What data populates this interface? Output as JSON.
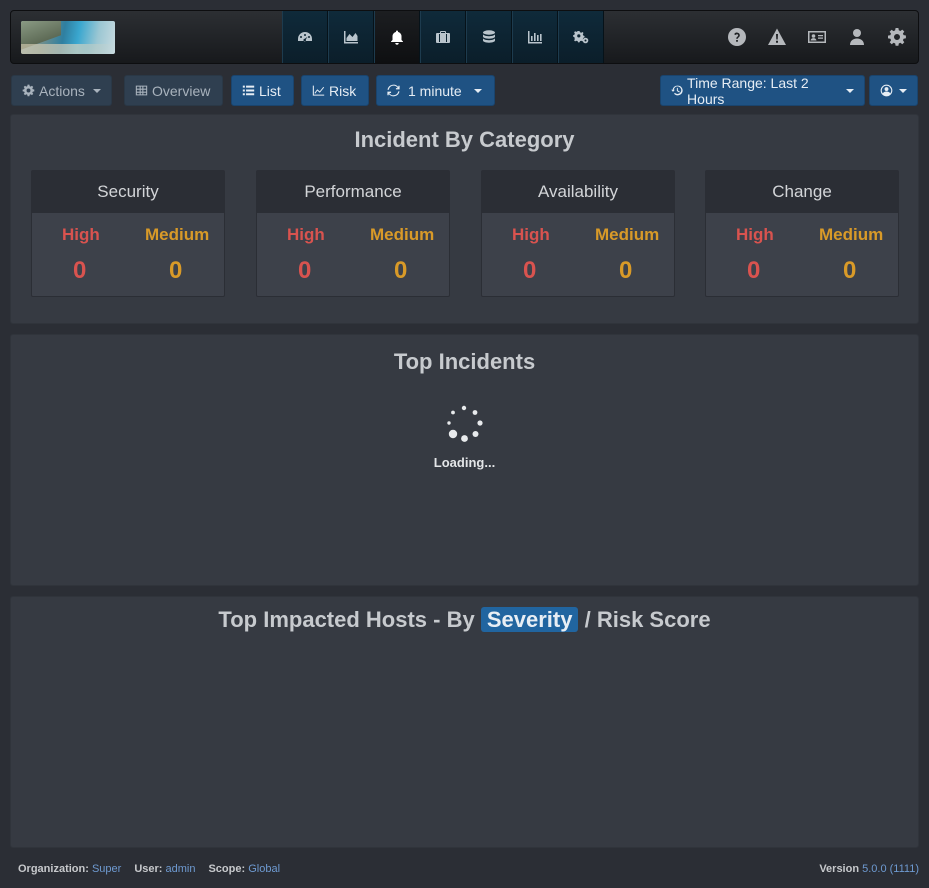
{
  "nav": {
    "logo": "landscape-logo",
    "icons": [
      {
        "name": "dashboard-icon",
        "active": false
      },
      {
        "name": "analytics-chart-icon",
        "active": false
      },
      {
        "name": "bell-icon",
        "active": true
      },
      {
        "name": "briefcase-icon",
        "active": false
      },
      {
        "name": "database-icon",
        "active": false
      },
      {
        "name": "bar-chart-icon",
        "active": false
      },
      {
        "name": "gears-icon",
        "active": false
      }
    ],
    "right_icons": [
      "help-icon",
      "warning-icon",
      "id-card-icon",
      "user-icon",
      "gear-icon"
    ]
  },
  "toolbar": {
    "actions_label": "Actions",
    "overview_label": "Overview",
    "list_label": "List",
    "risk_label": "Risk",
    "refresh_label": "1 minute",
    "time_range_label": "Time Range: Last 2 Hours"
  },
  "incident_by_category": {
    "title": "Incident By Category",
    "high_label": "High",
    "medium_label": "Medium",
    "categories": [
      {
        "name": "Security",
        "high": "0",
        "medium": "0"
      },
      {
        "name": "Performance",
        "high": "0",
        "medium": "0"
      },
      {
        "name": "Availability",
        "high": "0",
        "medium": "0"
      },
      {
        "name": "Change",
        "high": "0",
        "medium": "0"
      }
    ]
  },
  "top_incidents": {
    "title": "Top Incidents",
    "loading_text": "Loading..."
  },
  "top_hosts": {
    "title_prefix": "Top Impacted Hosts - By",
    "severity_label": "Severity",
    "separator": "/",
    "risk_label": "Risk Score"
  },
  "footer": {
    "org_label": "Organization:",
    "org_value": "Super",
    "user_label": "User:",
    "user_value": "admin",
    "scope_label": "Scope:",
    "scope_value": "Global",
    "version_label": "Version",
    "version_value": "5.0.0 (1111)"
  },
  "colors": {
    "high": "#d9534f",
    "medium": "#d99a28",
    "primary_button": "#1f5283",
    "link": "#6e9ad1"
  }
}
